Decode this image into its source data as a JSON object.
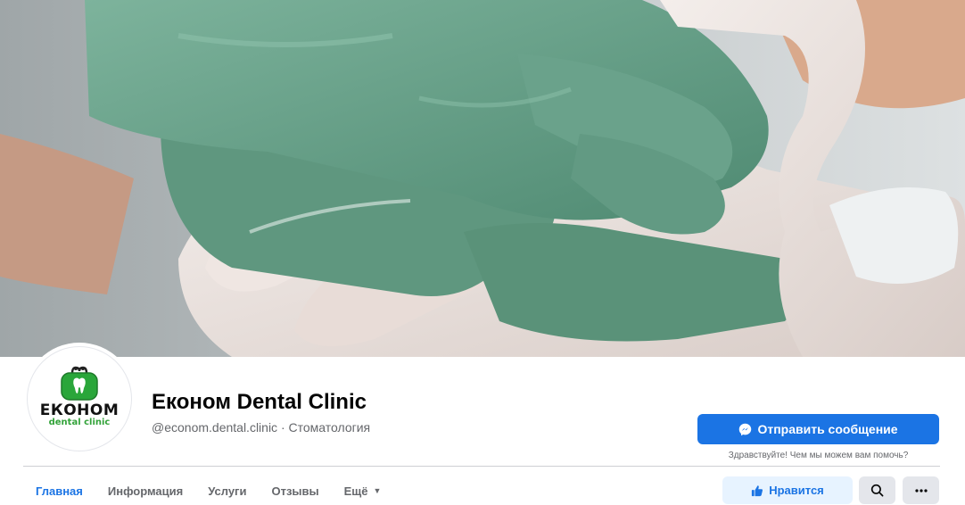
{
  "page": {
    "name": "Економ Dental Clinic",
    "handle_category": "@econom.dental.clinic · Стоматология"
  },
  "logo": {
    "word": "ЕКОНОМ",
    "sub": "dental clinic"
  },
  "actions": {
    "message_label": "Отправить сообщение",
    "message_hint": "Здравствуйте! Чем мы можем вам помочь?",
    "like_label": "Нравится"
  },
  "tabs": [
    {
      "label": "Главная",
      "active": true
    },
    {
      "label": "Информация"
    },
    {
      "label": "Услуги"
    },
    {
      "label": "Отзывы"
    },
    {
      "label": "Ещё"
    }
  ],
  "icons": {
    "messenger": "messenger-icon",
    "like": "thumbs-up-icon",
    "search": "search-icon",
    "more": "more-horizontal-icon",
    "caret": "caret-down-icon"
  },
  "colors": {
    "accent": "#1b74e4",
    "glove_green": "#6fa58f",
    "glove_white": "#ece3df",
    "logo_green": "#33a33a"
  }
}
